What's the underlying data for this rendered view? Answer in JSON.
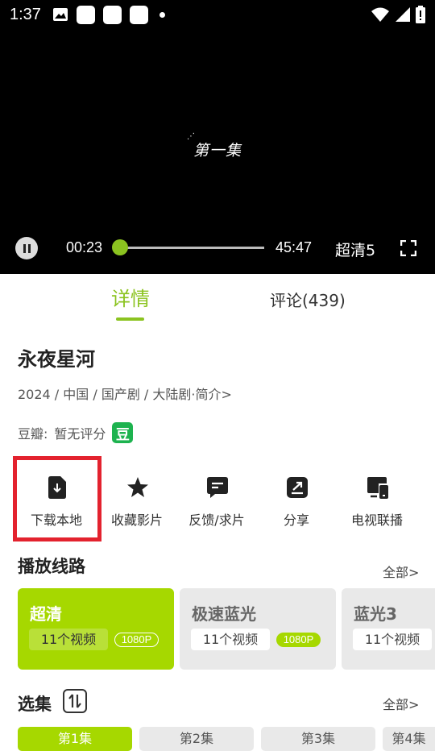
{
  "status_bar": {
    "time": "1:37"
  },
  "player": {
    "episode_title": "第一集",
    "current_time": "00:23",
    "total_time": "45:47",
    "quality": "超清5",
    "progress": 0.008
  },
  "tabs": [
    {
      "label": "详情",
      "active": true
    },
    {
      "label": "评论(439)",
      "active": false
    }
  ],
  "details": {
    "title": "永夜星河",
    "meta": "2024 / 中国 / 国产剧 / 大陆剧·简介>",
    "douban_label": "豆瓣:",
    "douban_value": "暂无评分",
    "douban_badge": "豆"
  },
  "actions": [
    {
      "label": "下载本地",
      "icon": "download-file-icon"
    },
    {
      "label": "收藏影片",
      "icon": "star-icon"
    },
    {
      "label": "反馈/求片",
      "icon": "feedback-icon"
    },
    {
      "label": "分享",
      "icon": "share-icon"
    },
    {
      "label": "电视联播",
      "icon": "tv-cast-icon"
    }
  ],
  "routes_section": {
    "title": "播放线路",
    "all_link": "全部>"
  },
  "routes": [
    {
      "name": "超清",
      "count": "11个视频",
      "badge": "1080P",
      "active": true
    },
    {
      "name": "极速蓝光",
      "count": "11个视频",
      "badge": "1080P",
      "active": false
    },
    {
      "name": "蓝光3",
      "count": "11个视频",
      "badge": "",
      "active": false
    }
  ],
  "episodes_section": {
    "title": "选集",
    "all_link": "全部>"
  },
  "episodes": [
    {
      "label": "第1集",
      "active": true
    },
    {
      "label": "第2集",
      "active": false
    },
    {
      "label": "第3集",
      "active": false
    },
    {
      "label": "第4集",
      "active": false
    }
  ],
  "colors": {
    "accent": "#a6d800",
    "highlight": "#e3222e",
    "douban": "#1db34f"
  }
}
